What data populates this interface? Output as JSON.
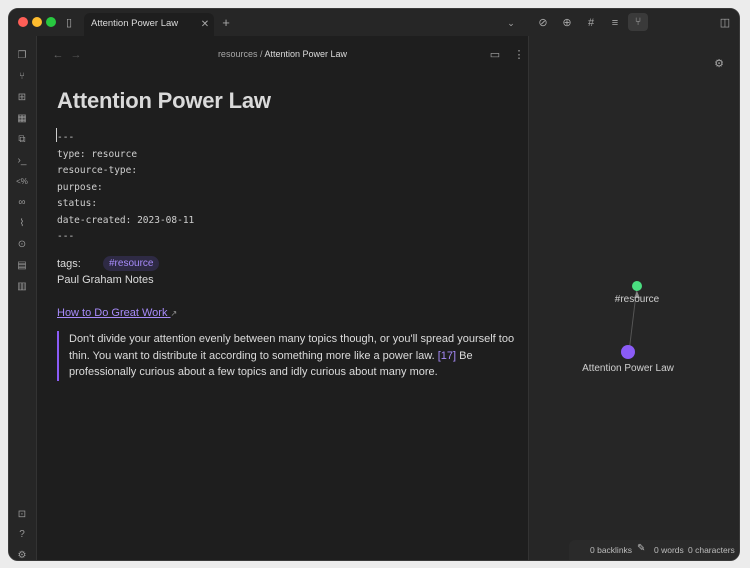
{
  "tab": {
    "title": "Attention Power Law"
  },
  "breadcrumb": {
    "folder": "resources",
    "separator": "/",
    "current": "Attention Power Law"
  },
  "note": {
    "title": "Attention Power Law",
    "frontmatter": "---\ntype: resource\nresource-type:\npurpose:\nstatus:\ndate-created: 2023-08-11\n---",
    "tags_label": "tags:",
    "tag": "#resource",
    "source_line": "Paul Graham Notes",
    "link_text": "How to Do Great Work",
    "quote_part1": "Don't divide your attention evenly between many topics though, or you'll spread yourself too thin. You want to distribute it according to something more like a power law.",
    "quote_ref": "[17]",
    "quote_part2": "Be professionally curious about a few topics and idly curious about many more."
  },
  "graph": {
    "nodes": [
      {
        "label": "#resource",
        "color": "#4ade80"
      },
      {
        "label": "Attention Power Law",
        "color": "#8b5cf6"
      }
    ]
  },
  "status_bar": {
    "backlinks": "0 backlinks",
    "words": "0 words",
    "characters": "0 characters"
  },
  "icons": {
    "titlebar": [
      "sidebar-toggle-icon",
      "close-icon",
      "plus-icon",
      "chevron-down-icon",
      "link-icon",
      "link-plus-icon",
      "hash-icon",
      "list-icon",
      "graph-icon",
      "right-sidebar-icon"
    ],
    "ribbon": [
      "files-icon",
      "graph-view-icon",
      "canvas-icon",
      "calendar-icon",
      "copy-icon",
      "terminal-icon",
      "template-icon",
      "link-icon",
      "attachment-icon",
      "map-pin-icon",
      "layout-icon",
      "table-icon",
      "vault-icon",
      "help-icon",
      "settings-icon"
    ]
  },
  "colors": {
    "accent": "#8b5cf6",
    "tag_green": "#4ade80",
    "background": "#1e1e1e"
  }
}
